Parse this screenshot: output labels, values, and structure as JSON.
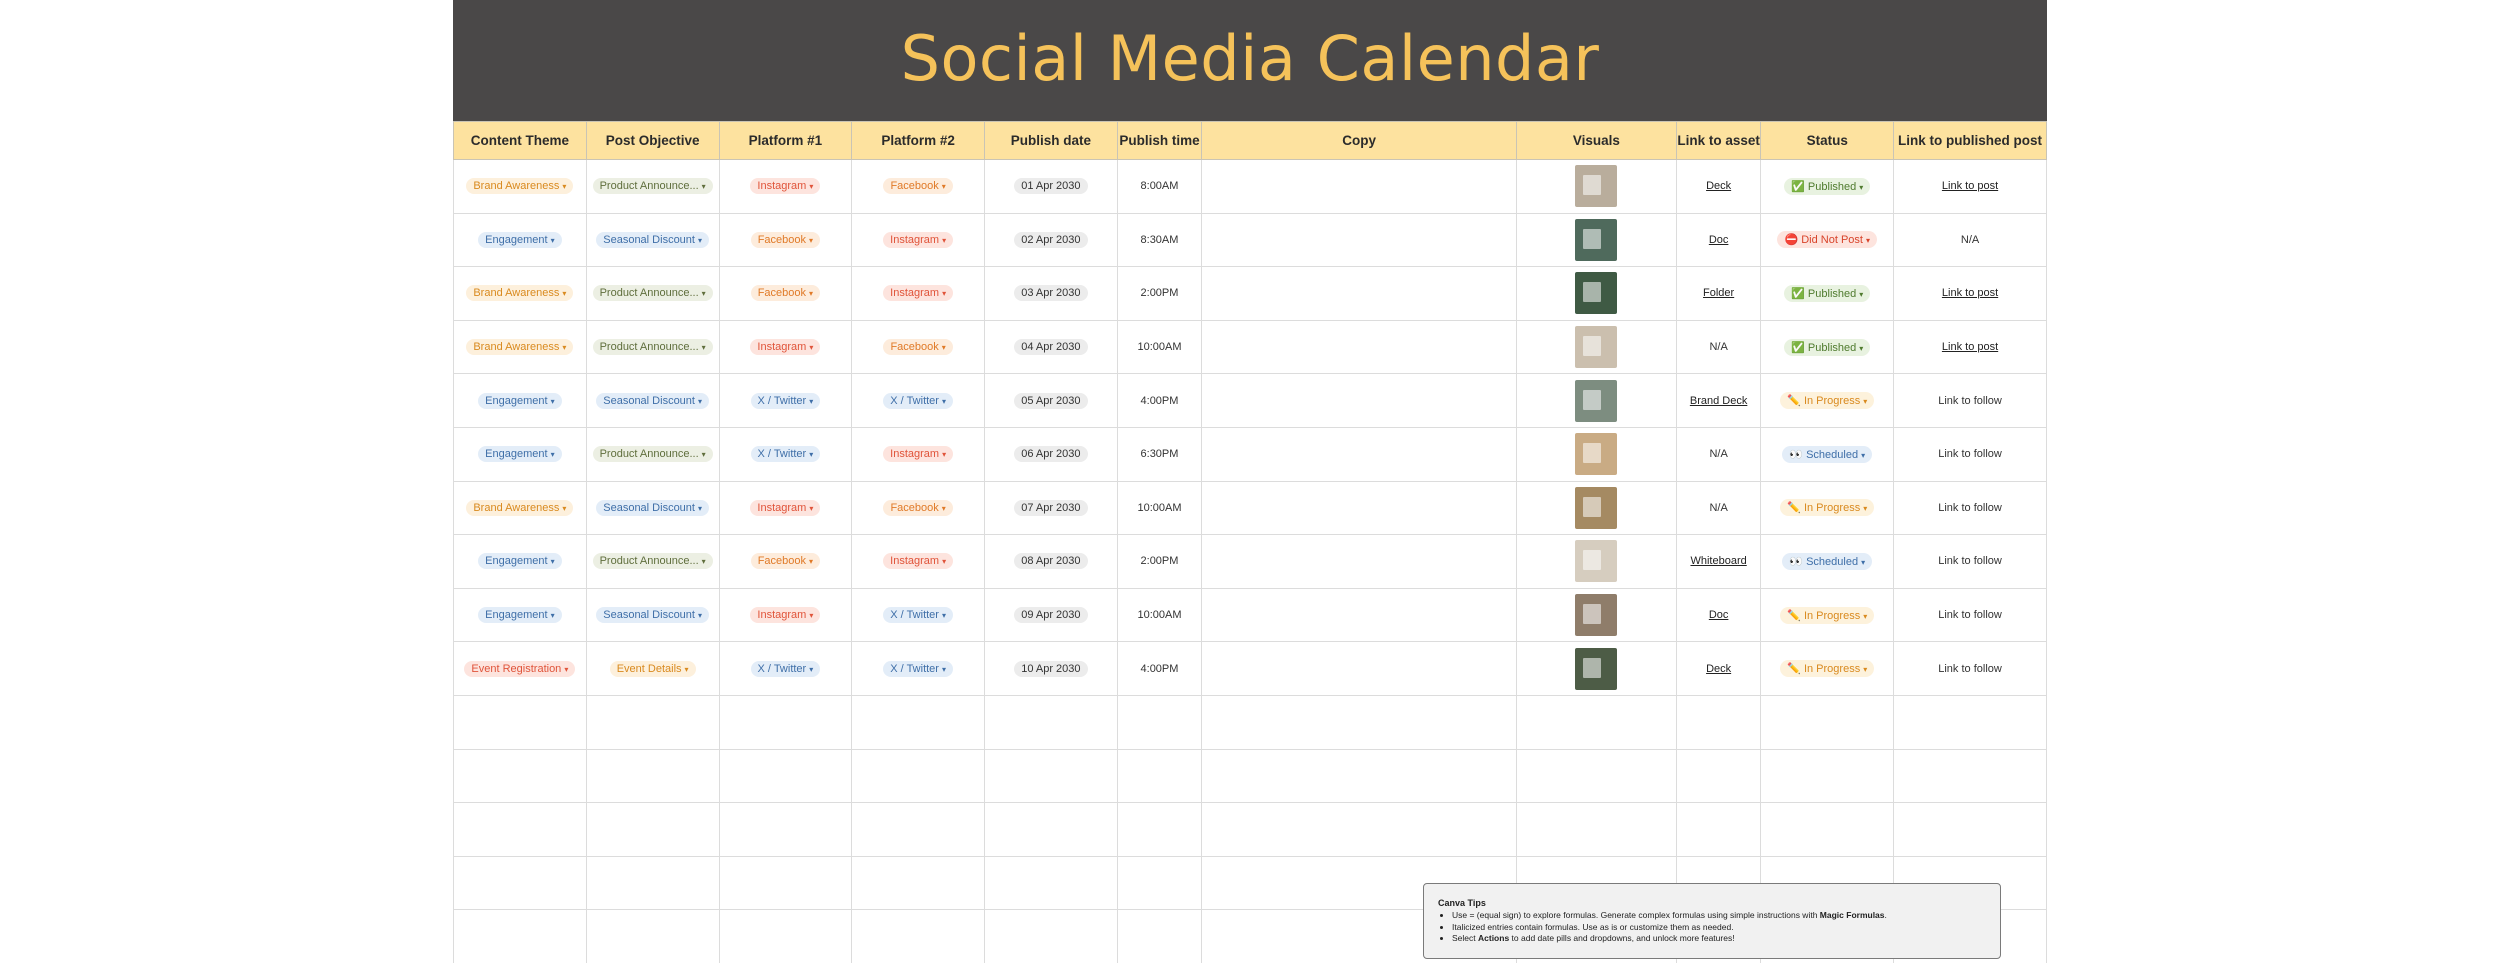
{
  "title": "Social Media Calendar",
  "columns": [
    "Content Theme",
    "Post Objective",
    "Platform #1",
    "Platform #2",
    "Publish date",
    "Publish time",
    "Copy",
    "Visuals",
    "Link to asset",
    "Status",
    "Link to published post"
  ],
  "rows": [
    {
      "theme": "Brand Awareness",
      "objective": "Product Announce...",
      "p1": "Instagram",
      "p2": "Facebook",
      "date": "01 Apr 2030",
      "time": "8:00AM",
      "copy": "",
      "asset": "Deck",
      "asset_link": true,
      "status": "✅ Published",
      "post": "Link to post",
      "post_link": true
    },
    {
      "theme": "Engagement",
      "objective": "Seasonal Discount",
      "p1": "Facebook",
      "p2": "Instagram",
      "date": "02 Apr 2030",
      "time": "8:30AM",
      "copy": "",
      "asset": "Doc",
      "asset_link": true,
      "status": "⛔ Did Not Post",
      "post": "N/A",
      "post_link": false
    },
    {
      "theme": "Brand Awareness",
      "objective": "Product Announce...",
      "p1": "Facebook",
      "p2": "Instagram",
      "date": "03 Apr 2030",
      "time": "2:00PM",
      "copy": "",
      "asset": "Folder",
      "asset_link": true,
      "status": "✅ Published",
      "post": "Link to post",
      "post_link": true
    },
    {
      "theme": "Brand Awareness",
      "objective": "Product Announce...",
      "p1": "Instagram",
      "p2": "Facebook",
      "date": "04 Apr 2030",
      "time": "10:00AM",
      "copy": "",
      "asset": "N/A",
      "asset_link": false,
      "status": "✅ Published",
      "post": "Link to post",
      "post_link": true
    },
    {
      "theme": "Engagement",
      "objective": "Seasonal Discount",
      "p1": "X / Twitter",
      "p2": "X / Twitter",
      "date": "05 Apr 2030",
      "time": "4:00PM",
      "copy": "",
      "asset": "Brand Deck",
      "asset_link": true,
      "status": "✏️ In Progress",
      "post": "Link to follow",
      "post_link": false
    },
    {
      "theme": "Engagement",
      "objective": "Product Announce...",
      "p1": "X / Twitter",
      "p2": "Instagram",
      "date": "06 Apr 2030",
      "time": "6:30PM",
      "copy": "",
      "asset": "N/A",
      "asset_link": false,
      "status": "👀 Scheduled",
      "post": "Link to follow",
      "post_link": false
    },
    {
      "theme": "Brand Awareness",
      "objective": "Seasonal Discount",
      "p1": "Instagram",
      "p2": "Facebook",
      "date": "07 Apr 2030",
      "time": "10:00AM",
      "copy": "",
      "asset": "N/A",
      "asset_link": false,
      "status": "✏️ In Progress",
      "post": "Link to follow",
      "post_link": false
    },
    {
      "theme": "Engagement",
      "objective": "Product Announce...",
      "p1": "Facebook",
      "p2": "Instagram",
      "date": "08 Apr 2030",
      "time": "2:00PM",
      "copy": "",
      "asset": "Whiteboard",
      "asset_link": true,
      "status": "👀 Scheduled",
      "post": "Link to follow",
      "post_link": false
    },
    {
      "theme": "Engagement",
      "objective": "Seasonal Discount",
      "p1": "Instagram",
      "p2": "X / Twitter",
      "date": "09 Apr 2030",
      "time": "10:00AM",
      "copy": "",
      "asset": "Doc",
      "asset_link": true,
      "status": "✏️ In Progress",
      "post": "Link to follow",
      "post_link": false
    },
    {
      "theme": "Event Registration",
      "objective": "Event Details",
      "p1": "X / Twitter",
      "p2": "X / Twitter",
      "date": "10 Apr 2030",
      "time": "4:00PM",
      "copy": "",
      "asset": "Deck",
      "asset_link": true,
      "status": "✏️ In Progress",
      "post": "Link to follow",
      "post_link": false
    }
  ],
  "empty_rows": 5,
  "tips": {
    "title": "Canva Tips",
    "line1_a": "Use = (equal sign) to explore formulas. Generate complex formulas using simple instructions with ",
    "line1_b": "Magic Formulas",
    "line1_c": ".",
    "line2": "Italicized entries contain formulas. Use as is or customize them as needed.",
    "line3_a": "Select ",
    "line3_b": "Actions",
    "line3_c": " to add date pills and dropdowns, and unlock more features!"
  },
  "pill_styles": {
    "Brand Awareness": {
      "bg": "#fdf0dc",
      "fg": "#d98a1f"
    },
    "Engagement": {
      "bg": "#e3edf8",
      "fg": "#3f6fa8"
    },
    "Event Registration": {
      "bg": "#fde4de",
      "fg": "#e0543a"
    },
    "Product Announce...": {
      "bg": "#ecefe3",
      "fg": "#5f6e3c"
    },
    "Seasonal Discount": {
      "bg": "#e3edf8",
      "fg": "#3f6fa8"
    },
    "Event Details": {
      "bg": "#fdf0dc",
      "fg": "#d98a1f"
    },
    "Instagram": {
      "bg": "#fde4de",
      "fg": "#e0543a"
    },
    "Facebook": {
      "bg": "#fdecdc",
      "fg": "#e07a28"
    },
    "X / Twitter": {
      "bg": "#e3edf8",
      "fg": "#3f6fa8"
    },
    "✅ Published": {
      "bg": "#e8f2e0",
      "fg": "#4f7b2e"
    },
    "⛔ Did Not Post": {
      "bg": "#fde4de",
      "fg": "#d8432a"
    },
    "✏️ In Progress": {
      "bg": "#fdf2dc",
      "fg": "#d98a1f"
    },
    "👀 Scheduled": {
      "bg": "#e3edf8",
      "fg": "#3f6fa8"
    }
  },
  "thumb_colors": [
    "#b9ad9c",
    "#4f6a5c",
    "#3f5a44",
    "#cbbfae",
    "#7d8d80",
    "#c9ab84",
    "#a58a62",
    "#d6cdbf",
    "#8f7d6a",
    "#4d5c46"
  ],
  "colors": {
    "banner": "#4a4848",
    "title": "#f5c25a",
    "header": "#fde29f"
  }
}
